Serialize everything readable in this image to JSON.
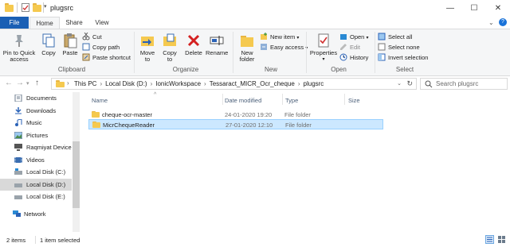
{
  "window": {
    "title": "plugsrc",
    "controls": [
      "minimize",
      "maximize",
      "close"
    ]
  },
  "tabs": [
    {
      "label": "File"
    },
    {
      "label": "Home"
    },
    {
      "label": "Share"
    },
    {
      "label": "View"
    }
  ],
  "ribbon": {
    "clipboard": {
      "group_label": "Clipboard",
      "pin_label_1": "Pin to Quick",
      "pin_label_2": "access",
      "copy_label": "Copy",
      "paste_label": "Paste",
      "cut_label": "Cut",
      "copy_path_label": "Copy path",
      "paste_shortcut_label": "Paste shortcut"
    },
    "organize": {
      "group_label": "Organize",
      "move_to_1": "Move",
      "move_to_2": "to",
      "copy_to_1": "Copy",
      "copy_to_2": "to",
      "delete_label": "Delete",
      "rename_label": "Rename"
    },
    "new": {
      "group_label": "New",
      "new_folder_1": "New",
      "new_folder_2": "folder",
      "new_item_label": "New item",
      "easy_access_label": "Easy access"
    },
    "open": {
      "group_label": "Open",
      "properties_label": "Properties",
      "open_label": "Open",
      "edit_label": "Edit",
      "history_label": "History"
    },
    "select": {
      "group_label": "Select",
      "select_all_label": "Select all",
      "select_none_label": "Select none",
      "invert_label": "Invert selection"
    }
  },
  "address": {
    "breadcrumb": [
      "This PC",
      "Local Disk (D:)",
      "IonicWorkspace",
      "Tessaract_MICR_Ocr_cheque",
      "plugsrc"
    ],
    "search_placeholder": "Search plugsrc"
  },
  "nav": {
    "items": [
      {
        "label": "Documents",
        "icon": "documents-icon"
      },
      {
        "label": "Downloads",
        "icon": "downloads-icon"
      },
      {
        "label": "Music",
        "icon": "music-icon"
      },
      {
        "label": "Pictures",
        "icon": "pictures-icon"
      },
      {
        "label": "Raqmiyat Device",
        "icon": "device-icon"
      },
      {
        "label": "Videos",
        "icon": "videos-icon"
      },
      {
        "label": "Local Disk (C:)",
        "icon": "drive-icon"
      },
      {
        "label": "Local Disk (D:)",
        "icon": "drive-icon"
      },
      {
        "label": "Local Disk (E:)",
        "icon": "drive-icon"
      },
      {
        "label": "Network",
        "icon": "network-icon"
      }
    ]
  },
  "columns": {
    "name": "Name",
    "date": "Date modified",
    "type": "Type",
    "size": "Size"
  },
  "files": [
    {
      "name": "cheque-ocr-master",
      "date": "24-01-2020 19:20",
      "type": "File folder",
      "size": ""
    },
    {
      "name": "MicrChequeReader",
      "date": "27-01-2020 12:10",
      "type": "File folder",
      "size": ""
    }
  ],
  "status": {
    "items_count": "2 items",
    "selected_count": "1 item selected"
  },
  "colors": {
    "accent": "#1a5fb4",
    "selection": "#cce8ff",
    "folder": "#f5c94f"
  }
}
